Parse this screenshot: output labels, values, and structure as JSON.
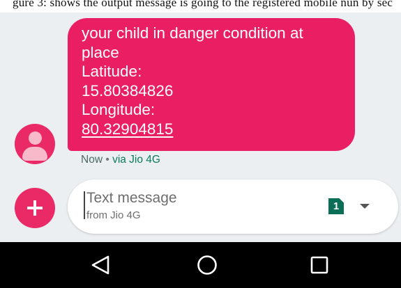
{
  "top_caption": "gure 3: shows the output message is going to the registered mobile nun by sec",
  "message": {
    "lines": [
      "your child in danger condition at",
      "place",
      "Latitude:",
      "15.80384826",
      "Longitude:",
      "80.32904815"
    ],
    "timestamp": "Now",
    "separator": " • ",
    "via": "via Jio 4G"
  },
  "compose": {
    "placeholder": "Text message",
    "sub_placeholder": "from Jio 4G",
    "sim_slot": "1"
  },
  "icons": {
    "avatar": "person-icon",
    "add": "plus-icon",
    "sim": "sim-card-icon",
    "dropdown": "chevron-down-icon",
    "nav": [
      "back-triangle-icon",
      "home-circle-icon",
      "recents-square-icon"
    ]
  },
  "colors": {
    "bubble": "#e91e63",
    "avatar": "#ea2a66",
    "background": "#eceff1",
    "sim": "#0b6e57",
    "navbar": "#000000"
  }
}
